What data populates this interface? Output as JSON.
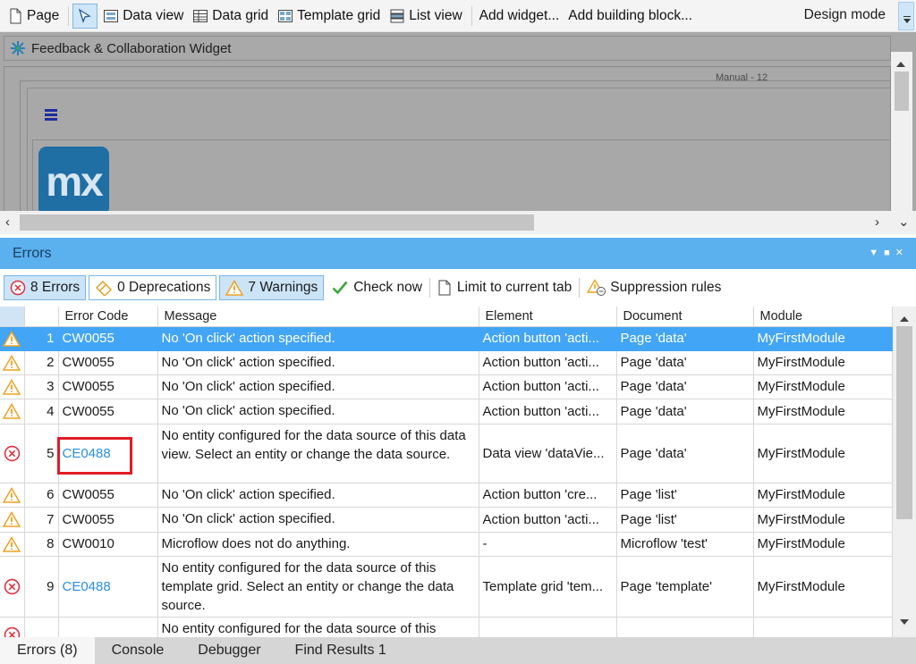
{
  "toolbar": {
    "items": [
      {
        "label": "Page",
        "icon": "page-icon"
      },
      {
        "label": "",
        "icon": "select-pointer-icon"
      },
      {
        "label": "Data view",
        "icon": "data-view-icon"
      },
      {
        "label": "Data grid",
        "icon": "data-grid-icon"
      },
      {
        "label": "Template grid",
        "icon": "template-grid-icon"
      },
      {
        "label": "List view",
        "icon": "list-view-icon"
      },
      {
        "label": "Add widget...",
        "icon": ""
      },
      {
        "label": "Add building block...",
        "icon": ""
      }
    ],
    "mode": "Design mode"
  },
  "canvas": {
    "widget_title": "Feedback & Collaboration Widget",
    "layout_label": "Manual - 12",
    "logo_text": "mx"
  },
  "errors_panel": {
    "title": "Errors",
    "filters": {
      "errors": "8 Errors",
      "deprecations": "0 Deprecations",
      "warnings": "7 Warnings",
      "check_now": "Check now",
      "limit": "Limit to current tab",
      "suppression": "Suppression rules"
    },
    "columns": [
      "",
      "",
      "Error Code",
      "Message",
      "Element",
      "Document",
      "Module"
    ],
    "rows": [
      {
        "type": "warning",
        "num": "1",
        "code": "CW0055",
        "message": "No 'On click' action specified.",
        "element": "Action button 'acti...",
        "document": "Page 'data'",
        "module": "MyFirstModule",
        "selected": true
      },
      {
        "type": "warning",
        "num": "2",
        "code": "CW0055",
        "message": "No 'On click' action specified.",
        "element": "Action button 'acti...",
        "document": "Page 'data'",
        "module": "MyFirstModule"
      },
      {
        "type": "warning",
        "num": "3",
        "code": "CW0055",
        "message": "No 'On click' action specified.",
        "element": "Action button 'acti...",
        "document": "Page 'data'",
        "module": "MyFirstModule"
      },
      {
        "type": "warning",
        "num": "4",
        "code": "CW0055",
        "message": "No 'On click' action specified.",
        "element": "Action button 'acti...",
        "document": "Page 'data'",
        "module": "MyFirstModule"
      },
      {
        "type": "error",
        "num": "5",
        "code": "CE0488",
        "message": "No entity configured for the data source of this data view. Select an entity or change the data source.",
        "element": "Data view 'dataVie...",
        "document": "Page 'data'",
        "module": "MyFirstModule"
      },
      {
        "type": "warning",
        "num": "6",
        "code": "CW0055",
        "message": "No 'On click' action specified.",
        "element": "Action button 'cre...",
        "document": "Page 'list'",
        "module": "MyFirstModule"
      },
      {
        "type": "warning",
        "num": "7",
        "code": "CW0055",
        "message": "No 'On click' action specified.",
        "element": "Action button 'acti...",
        "document": "Page 'list'",
        "module": "MyFirstModule"
      },
      {
        "type": "warning",
        "num": "8",
        "code": "CW0010",
        "message": "Microflow does not do anything.",
        "element": "-",
        "document": "Microflow 'test'",
        "module": "MyFirstModule"
      },
      {
        "type": "error",
        "num": "9",
        "code": "CE0488",
        "message": "No entity configured for the data source of this template grid. Select an entity or change the data source.",
        "element": "Template grid 'tem...",
        "document": "Page 'template'",
        "module": "MyFirstModule"
      },
      {
        "type": "error",
        "num": "",
        "code": "",
        "message": "No entity configured for the data source of this",
        "element": "",
        "document": "",
        "module": ""
      }
    ]
  },
  "bottom_tabs": [
    "Errors (8)",
    "Console",
    "Debugger",
    "Find Results 1"
  ],
  "colors": {
    "accent": "#42a5f5",
    "header": "#5bb0ee",
    "link": "#2a8ee0",
    "highlight_box": "#e01b24",
    "warning": "#f0a020",
    "error": "#e0303a"
  }
}
